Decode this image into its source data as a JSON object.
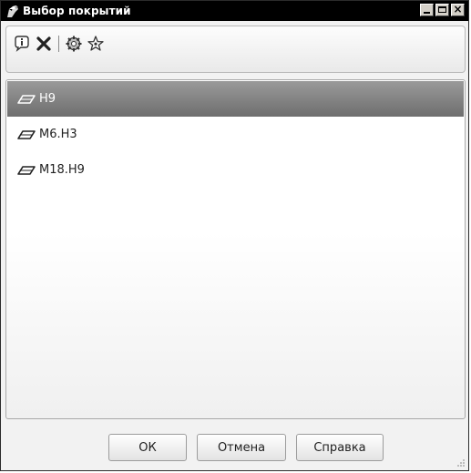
{
  "window": {
    "title": "Выбор покрытий",
    "controls": [
      "minimize",
      "maximize",
      "close"
    ],
    "close_glyph": "×"
  },
  "toolbar": {
    "buttons": [
      {
        "name": "info-icon"
      },
      {
        "name": "delete-icon"
      },
      {
        "name": "settings-icon"
      },
      {
        "name": "favorite-star-icon"
      }
    ]
  },
  "list": {
    "items": [
      {
        "label": "Н9",
        "selected": true
      },
      {
        "label": "М6.Н3",
        "selected": false
      },
      {
        "label": "М18.Н9",
        "selected": false
      }
    ]
  },
  "buttons": {
    "ok": "ОК",
    "cancel": "Отмена",
    "help": "Справка"
  },
  "colors": {
    "titlebar": "#000000",
    "selection": "#7f7f7f",
    "window_bg": "#f2f2f2"
  }
}
